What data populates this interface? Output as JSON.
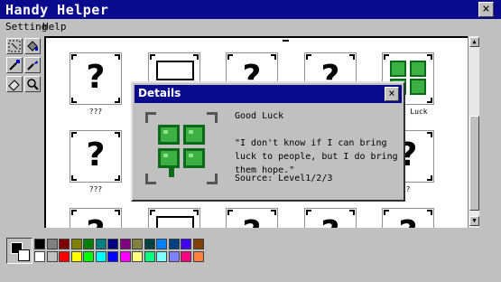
{
  "window": {
    "title": "Handy Helper",
    "close_label": "×"
  },
  "menu": {
    "items": [
      "Setting",
      "Help"
    ]
  },
  "tools": [
    {
      "icon": "selection-icon"
    },
    {
      "icon": "bucket-icon"
    },
    {
      "icon": "eyedropper-icon"
    },
    {
      "icon": "brush-icon"
    },
    {
      "icon": "eraser-icon"
    },
    {
      "icon": "magnifier-icon"
    }
  ],
  "grid": {
    "rows": [
      [
        {
          "kind": "unknown",
          "glyph": "?",
          "label": "???"
        },
        {
          "kind": "scribble",
          "glyph": "",
          "label": ""
        },
        {
          "kind": "unknown",
          "glyph": "?",
          "label": ""
        },
        {
          "kind": "unknown",
          "glyph": "?",
          "label": ""
        },
        {
          "kind": "clover",
          "glyph": "",
          "label": "Luck"
        }
      ],
      [
        {
          "kind": "unknown",
          "glyph": "?",
          "label": "???"
        },
        {
          "kind": "blank",
          "glyph": "",
          "label": ""
        },
        {
          "kind": "blank",
          "glyph": "",
          "label": ""
        },
        {
          "kind": "blank",
          "glyph": "",
          "label": ""
        },
        {
          "kind": "unknown",
          "glyph": "?",
          "label": "?"
        }
      ],
      [
        {
          "kind": "unknown",
          "glyph": "?",
          "label": ""
        },
        {
          "kind": "scribble",
          "glyph": "",
          "label": ""
        },
        {
          "kind": "unknown",
          "glyph": "?",
          "label": ""
        },
        {
          "kind": "unknown",
          "glyph": "?",
          "label": ""
        },
        {
          "kind": "unknown",
          "glyph": "?",
          "label": ""
        }
      ]
    ]
  },
  "dialog": {
    "title": "Details",
    "close_label": "×",
    "item_name": "Good Luck",
    "quote": "\"I don't know if I can bring luck to people, but I do bring them hope.\"",
    "source": "Source: Level1/2/3"
  },
  "scroll": {
    "up": "▲",
    "down": "▼"
  },
  "palette": {
    "row1": [
      "#000000",
      "#808080",
      "#800000",
      "#808000",
      "#008000",
      "#008080",
      "#000080",
      "#800080",
      "#808040",
      "#004040",
      "#0080ff",
      "#004080",
      "#4000ff",
      "#804000"
    ],
    "row2": [
      "#ffffff",
      "#c0c0c0",
      "#ff0000",
      "#ffff00",
      "#00ff00",
      "#00ffff",
      "#0000ff",
      "#ff00ff",
      "#ffff80",
      "#00ff80",
      "#80ffff",
      "#8080ff",
      "#ff0080",
      "#ff8040"
    ]
  },
  "colors": {
    "titlebar": "#0a0a8c",
    "clover_green": "#3cb043",
    "clover_dark": "#0a6a1a"
  }
}
